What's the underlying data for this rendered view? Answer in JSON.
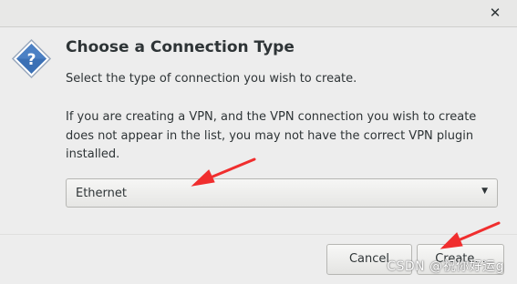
{
  "window": {
    "close_symbol": "✕",
    "close_icon": "close-icon",
    "dialog_icon": "question-icon",
    "accent_color": "#3b70b5"
  },
  "dialog": {
    "title": "Choose a Connection Type",
    "subtitle": "Select the type of connection you wish to create.",
    "info_text": "If you are creating a VPN, and the VPN connection you wish to create does not appear in the list, you may not have the correct VPN plugin installed."
  },
  "connection_type": {
    "selected": "Ethernet",
    "arrow_symbol": "▼"
  },
  "buttons": {
    "cancel": "Cancel",
    "create": "Create..."
  },
  "annotations": {
    "arrow_color": "#f02e2e"
  },
  "watermark": "CSDN @祝你好运g"
}
